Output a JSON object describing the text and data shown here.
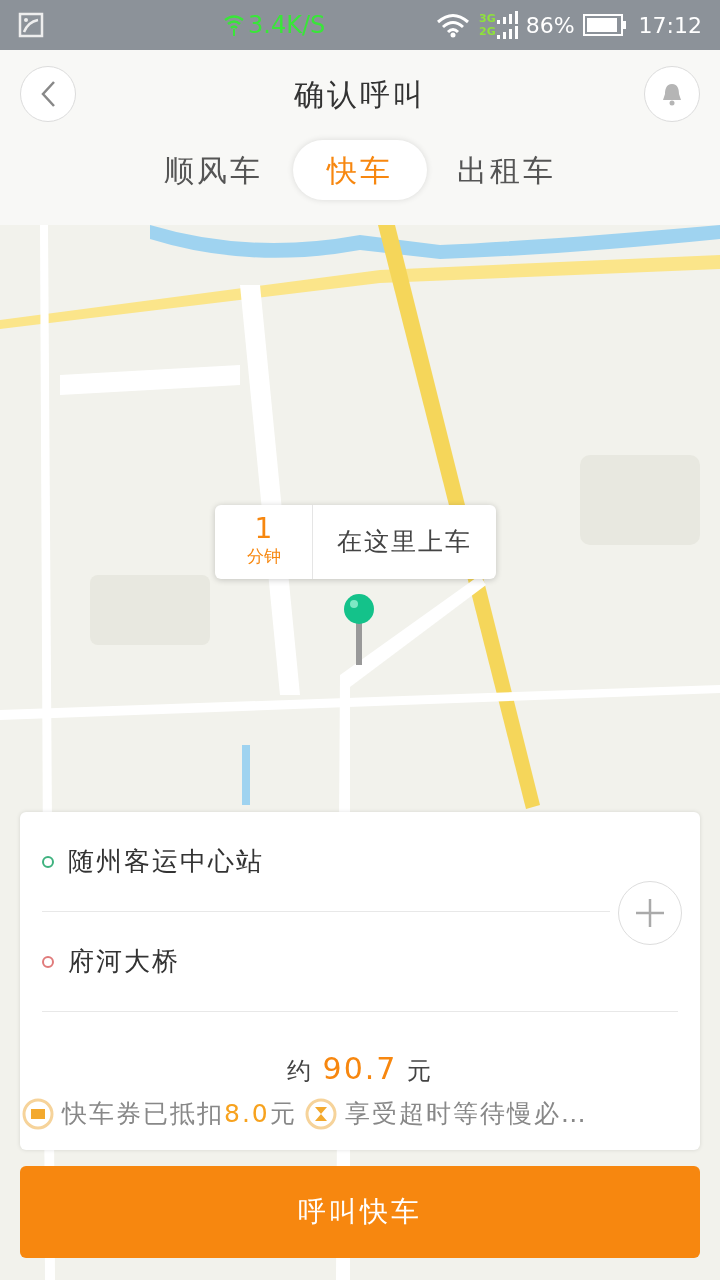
{
  "status_bar": {
    "speed": "3.4K/S",
    "network_top": "3G",
    "network_bottom": "2G",
    "battery": "86%",
    "time": "17:12"
  },
  "header": {
    "title": "确认呼叫"
  },
  "tabs": [
    {
      "label": "顺风车",
      "selected": false
    },
    {
      "label": "快车",
      "selected": true
    },
    {
      "label": "出租车",
      "selected": false
    }
  ],
  "map": {
    "eta_value": "1",
    "eta_unit": "分钟",
    "pickup_label": "在这里上车"
  },
  "route": [
    {
      "place": "随州客运中心站",
      "color": "#3fb27f"
    },
    {
      "place": "府河大桥",
      "color": "#e07b7b"
    }
  ],
  "price": {
    "prefix": "约",
    "amount": "90.7",
    "suffix": "元"
  },
  "promos": [
    {
      "before": "快车券已抵扣",
      "amount": "8.0",
      "after": "元"
    },
    {
      "before": "享受超时等待慢必…"
    }
  ],
  "call_button": "呼叫快车"
}
